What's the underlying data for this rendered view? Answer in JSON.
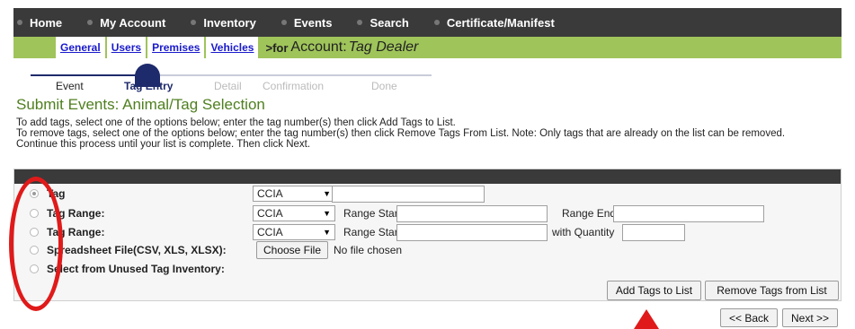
{
  "topnav": {
    "items": [
      "Home",
      "My Account",
      "Inventory",
      "Events",
      "Search",
      "Certificate/Manifest"
    ]
  },
  "subnav": {
    "links": [
      "General",
      "Users",
      "Premises",
      "Vehicles"
    ],
    "for_text": ">for",
    "account_label": "Account:",
    "account_name": "Tag Dealer"
  },
  "steps": [
    "Event",
    "Tag Entry",
    "Detail",
    "Confirmation",
    "Done"
  ],
  "page_title": "Submit Events: Animal/Tag Selection",
  "instructions": [
    "To add tags, select one of the options below; enter the tag number(s) then click Add Tags to List.",
    "To remove tags, select one of the options below; enter the tag number(s) then click Remove Tags From List. Note: Only tags that are already on the list can be removed.",
    "Continue this process until your list is complete. Then click Next."
  ],
  "options": {
    "tag": {
      "label": "Tag",
      "select_value": "CCIA",
      "selected": true
    },
    "tag_range": {
      "label": "Tag Range:",
      "select_value": "CCIA",
      "start_label": "Range Start",
      "end_label": "Range End"
    },
    "tag_quantity": {
      "label": "Tag Range:",
      "select_value": "CCIA",
      "start_label": "Range Start",
      "quantity_label": "with Quantity"
    },
    "spreadsheet": {
      "label": "Spreadsheet File(CSV, XLS, XLSX):",
      "button": "Choose File",
      "status": "No file chosen"
    },
    "unused": {
      "label": "Select from Unused Tag Inventory:"
    }
  },
  "buttons": {
    "add": "Add Tags to List",
    "remove": "Remove Tags from List",
    "back": "<< Back",
    "next": "Next >>"
  },
  "colors": {
    "nav_bg": "#3a3a3a",
    "subnav_bg": "#9fc45a",
    "title_green": "#4f7f1f",
    "annotation_red": "#e01a1a"
  }
}
